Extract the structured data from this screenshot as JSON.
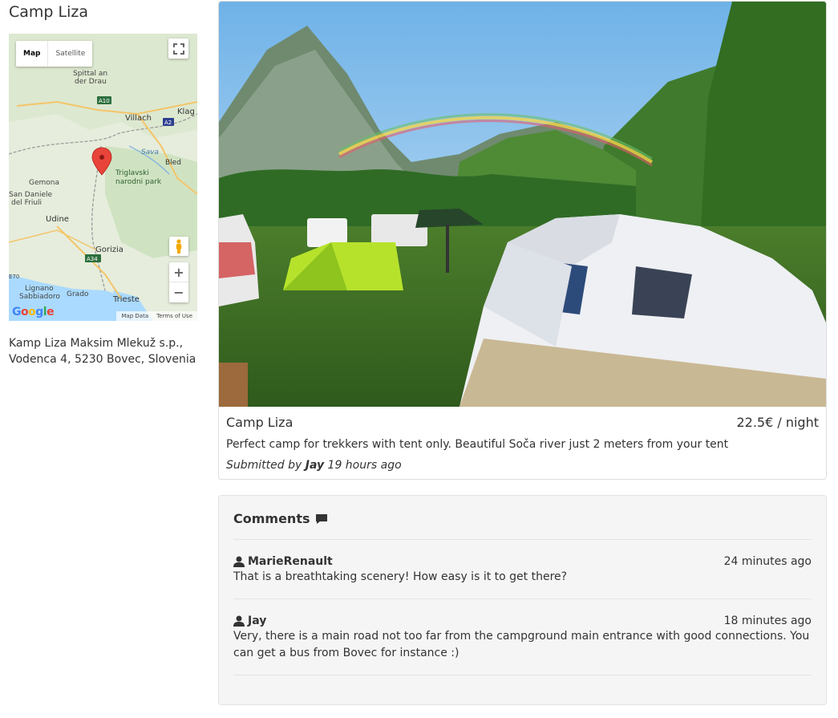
{
  "sidebar": {
    "heading": "Camp Liza",
    "map": {
      "type_map": "Map",
      "type_satellite": "Satellite",
      "footer_data": "Map Data",
      "footer_terms": "Terms of Use",
      "logo": "Google",
      "labels": [
        "Spittal an der Drau",
        "A10",
        "Villach",
        "Klagenfurt",
        "A2",
        "Sava",
        "Bled",
        "Triglavski narodni park",
        "Gemona",
        "San Daniele del Friuli",
        "Udine",
        "Gorizia",
        "A34",
        "Lignano Sabbiadoro",
        "Grado",
        "Trieste",
        "A2",
        "E70"
      ]
    },
    "address": "Kamp Liza Maksim Mlekuž s.p., Vodenca 4, 5230 Bovec, Slovenia"
  },
  "camp": {
    "title": "Camp Liza",
    "price": "22.5€ / night",
    "description": "Perfect camp for trekkers with tent only. Beautiful Soča river just 2 meters from your tent",
    "submitted_prefix": "Submitted by",
    "submitted_author": "Jay",
    "submitted_time": "19 hours ago"
  },
  "comments": {
    "title": "Comments",
    "items": [
      {
        "author": "MarieRenault",
        "time": "24 minutes ago",
        "text": "That is a breathtaking scenery! How easy is it to get there?"
      },
      {
        "author": "Jay",
        "time": "18 minutes ago",
        "text": "Very, there is a main road not too far from the campground main entrance with good connections. You can get a bus from Bovec for instance :)"
      }
    ]
  }
}
